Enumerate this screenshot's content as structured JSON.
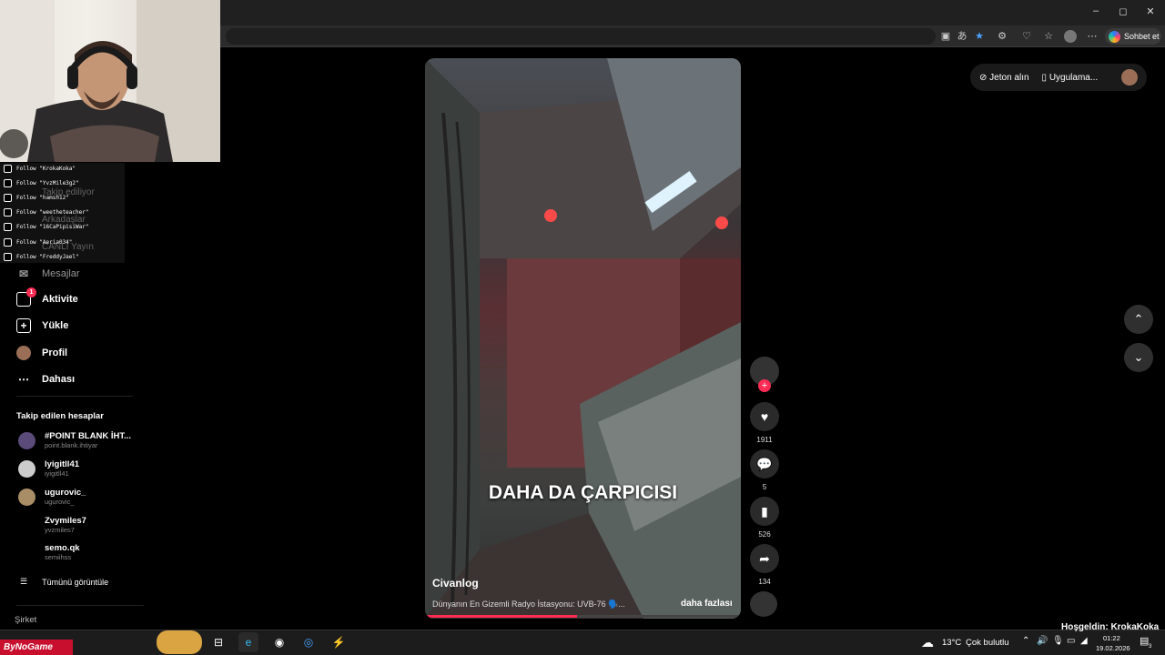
{
  "browser": {
    "copilot_label": "Sohbet et",
    "minimize": "–",
    "maximize": "◻",
    "close": "✕"
  },
  "webcam": {
    "follows": [
      "Follow \"KrokaKoka\"",
      "Follow \"YvzMile3g2\"",
      "Follow \"hamsh12\"",
      "Follow \"weetheteacher\"",
      "Follow \"16CaPipisiWar\"",
      "Follow \"Aeria034\"",
      "Follow \"FreddyJael\""
    ],
    "behind_text": [
      "Takip ediliyor",
      "Arkadaşlar",
      "CANLI Yayın"
    ]
  },
  "sidebar": {
    "items": [
      {
        "label": "Mesajlar",
        "icon": "message-icon"
      },
      {
        "label": "Aktivite",
        "icon": "activity-icon",
        "badge": "1"
      },
      {
        "label": "Yükle",
        "icon": "upload-icon"
      },
      {
        "label": "Profil",
        "icon": "profile-avatar"
      },
      {
        "label": "Dahası",
        "icon": "more-icon"
      }
    ],
    "following_title": "Takip edilen hesaplar",
    "accounts": [
      {
        "name": "#POINT BLANK İHT...",
        "handle": "point.blank.ihtiyar"
      },
      {
        "name": "lyigitll41",
        "handle": "iyigitll41"
      },
      {
        "name": "ugurovic_",
        "handle": "ugurovic_"
      },
      {
        "name": "Zvymiles7",
        "handle": "yvzmiles7"
      },
      {
        "name": "semo.qk",
        "handle": "semiihss"
      }
    ],
    "see_all": "Tümünü görüntüle",
    "company": "Şirket"
  },
  "video": {
    "caption": "DAHA DA ÇARPICISI",
    "author": "Civanlog",
    "description": "Dünyanın En Gizemli Radyo İstasyonu: UVB-76 🗣️...",
    "more": "daha fazlası",
    "progress": 0.48
  },
  "actions": {
    "likes": "1911",
    "comments": "5",
    "saves": "526",
    "shares": "134"
  },
  "topbar": {
    "coins": "Jeton alın",
    "app": "Uygulama..."
  },
  "taskbar": {
    "streamer_brand": "ByNoGame",
    "weather_temp": "13°C",
    "weather_text": "Çok bulutlu",
    "time": "01:22",
    "date": "19.02.2026",
    "notification_count": "3",
    "welcome": "Hoşgeldin: KrokaKoka"
  },
  "colors": {
    "accent": "#fe2c55",
    "bg": "#000000"
  }
}
